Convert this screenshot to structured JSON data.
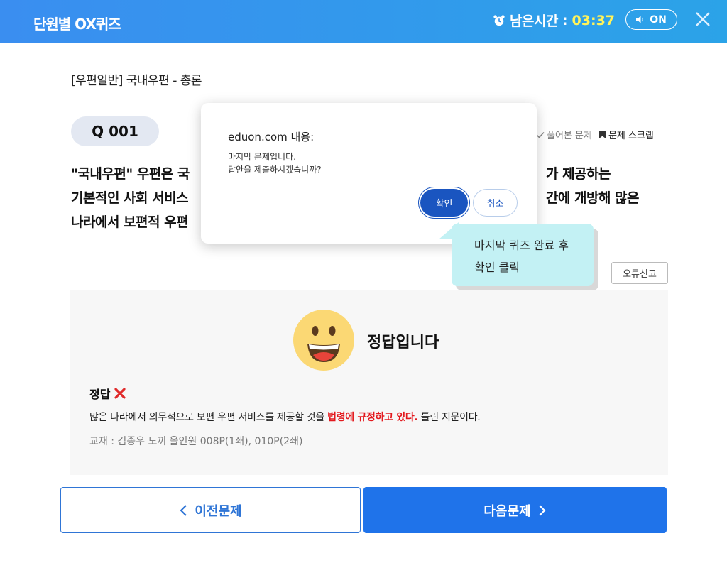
{
  "header": {
    "title": "단원별 OX퀴즈",
    "timer_label": "남은시간",
    "timer_sep": ":",
    "timer_value": "03:37",
    "sound_label": "ON"
  },
  "breadcrumb": "[우편일반] 국내우편 - 총론",
  "question": {
    "number": "Q 001",
    "solved_label": "풀어본 문제",
    "scrap_label": "문제 스크랩",
    "line1": "\"국내우편\" 우편은 국",
    "line1_right": "가 제공하는",
    "line2": "기본적인 사회 서비스",
    "line2_right": "간에 개방해 많은",
    "line3": "나라에서 보편적 우편",
    "report_label": "오류신고"
  },
  "result": {
    "title": "정답입니다",
    "answer_label": "정답",
    "explain_before": "많은 나라에서 의무적으로 보편 우편 서비스를 제공할 것을 ",
    "explain_highlight": "법령에 규정하고 있다.",
    "explain_after": " 틀린 지문이다.",
    "source": "교재 : 김종우 도끼 올인원 008P(1쇄), 010P(2쇄)"
  },
  "nav": {
    "prev_label": "이전문제",
    "next_label": "다음문제"
  },
  "dialog": {
    "title": "eduon.com 내용:",
    "message_line1": "마지막 문제입니다.",
    "message_line2": "답안을 제출하시겠습니까?",
    "ok_label": "확인",
    "cancel_label": "취소"
  },
  "tooltip": {
    "line1": "마지막 퀴즈 완료 후",
    "line2": "확인 클릭"
  },
  "colors": {
    "header_start": "#3a8ef0",
    "header_end": "#2ba3e8",
    "timer_value": "#fff35a",
    "primary": "#1f73ea",
    "highlight": "#e3191e",
    "tooltip_bg": "#c3f1f4"
  },
  "icons": {
    "timer": "alarm-clock-icon",
    "sound": "speaker-icon",
    "close": "close-icon",
    "solved": "check-icon",
    "scrap": "bookmark-icon",
    "answer": "x-mark-icon",
    "smiley": "smiley-face-icon"
  }
}
